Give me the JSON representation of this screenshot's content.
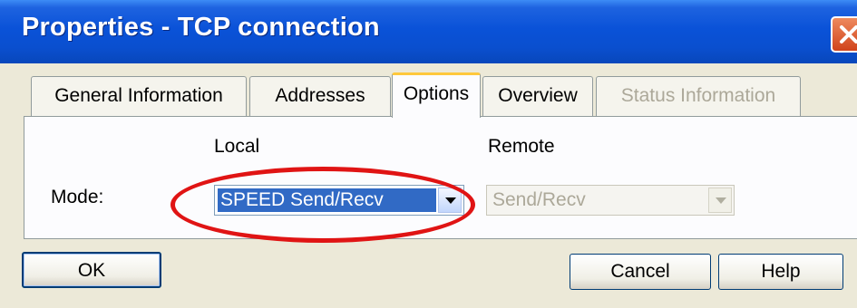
{
  "window": {
    "title": "Properties - TCP connection",
    "close_icon": "close-icon",
    "colors": {
      "title_bar": "#0a52d8",
      "close_button": "#d9542a",
      "dialog_bg": "#ece9d8",
      "highlight_ellipse": "#e01414",
      "selection": "#316ac5"
    }
  },
  "tabs": [
    {
      "label": "General Information",
      "state": "normal"
    },
    {
      "label": "Addresses",
      "state": "normal"
    },
    {
      "label": "Options",
      "state": "active"
    },
    {
      "label": "Overview",
      "state": "normal"
    },
    {
      "label": "Status Information",
      "state": "disabled"
    }
  ],
  "options": {
    "local_header": "Local",
    "remote_header": "Remote",
    "mode_label": "Mode:",
    "local_mode": {
      "value": "SPEED Send/Recv",
      "enabled": true,
      "icon": "dropdown-arrow-icon"
    },
    "remote_mode": {
      "value": "Send/Recv",
      "enabled": false,
      "icon": "dropdown-arrow-icon"
    }
  },
  "buttons": {
    "ok": "OK",
    "cancel": "Cancel",
    "help": "Help"
  }
}
